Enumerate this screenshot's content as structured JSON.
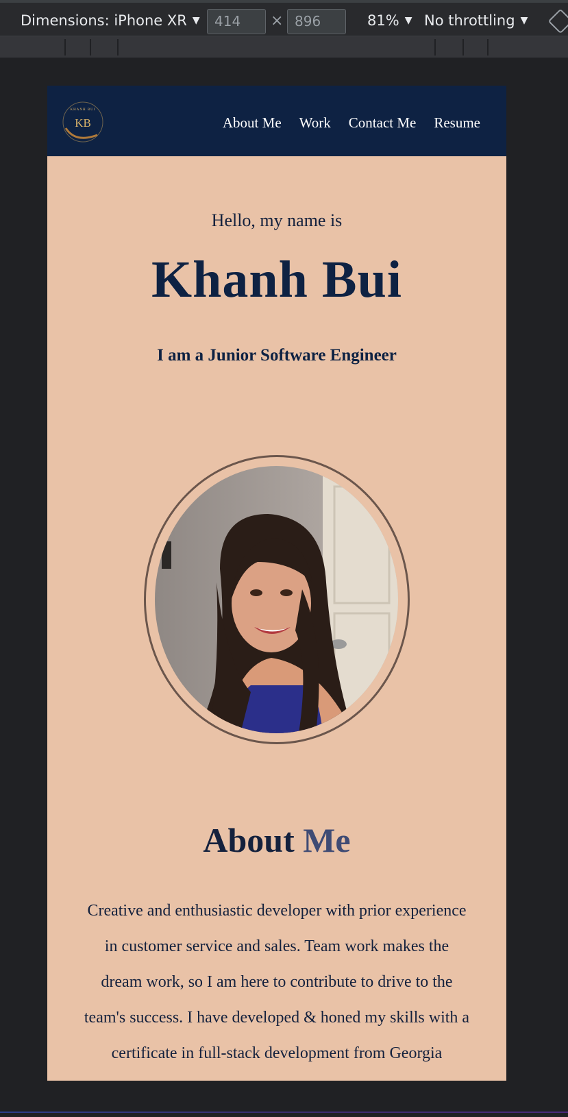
{
  "devtools": {
    "dimensions_label": "Dimensions: iPhone XR",
    "width_value": "414",
    "height_value": "896",
    "times_glyph": "×",
    "zoom_label": "81%",
    "throttling_label": "No throttling",
    "caret": "▼"
  },
  "site": {
    "logo_text": "KHANH BUI",
    "logo_monogram": "KB",
    "nav": [
      "About Me",
      "Work",
      "Contact Me",
      "Resume"
    ],
    "hero": {
      "greeting": "Hello, my name is",
      "name": "Khanh Bui",
      "role": "I am a Junior Software Engineer"
    },
    "about": {
      "title_main": "About",
      "title_accent": "Me",
      "text": "Creative and enthusiastic developer with prior experience in customer service and sales. Team work makes the dream work, so I am here to contribute to drive to the team's success. I have developed & honed my skills with a certificate in full-stack development from Georgia Institute of Technology. Through this"
    }
  },
  "colors": {
    "navbar": "#0e2243",
    "page_bg": "#e9c2a7",
    "heading": "#0e2243",
    "accent": "#3f4b74",
    "devtools_bg": "#292a2d"
  }
}
